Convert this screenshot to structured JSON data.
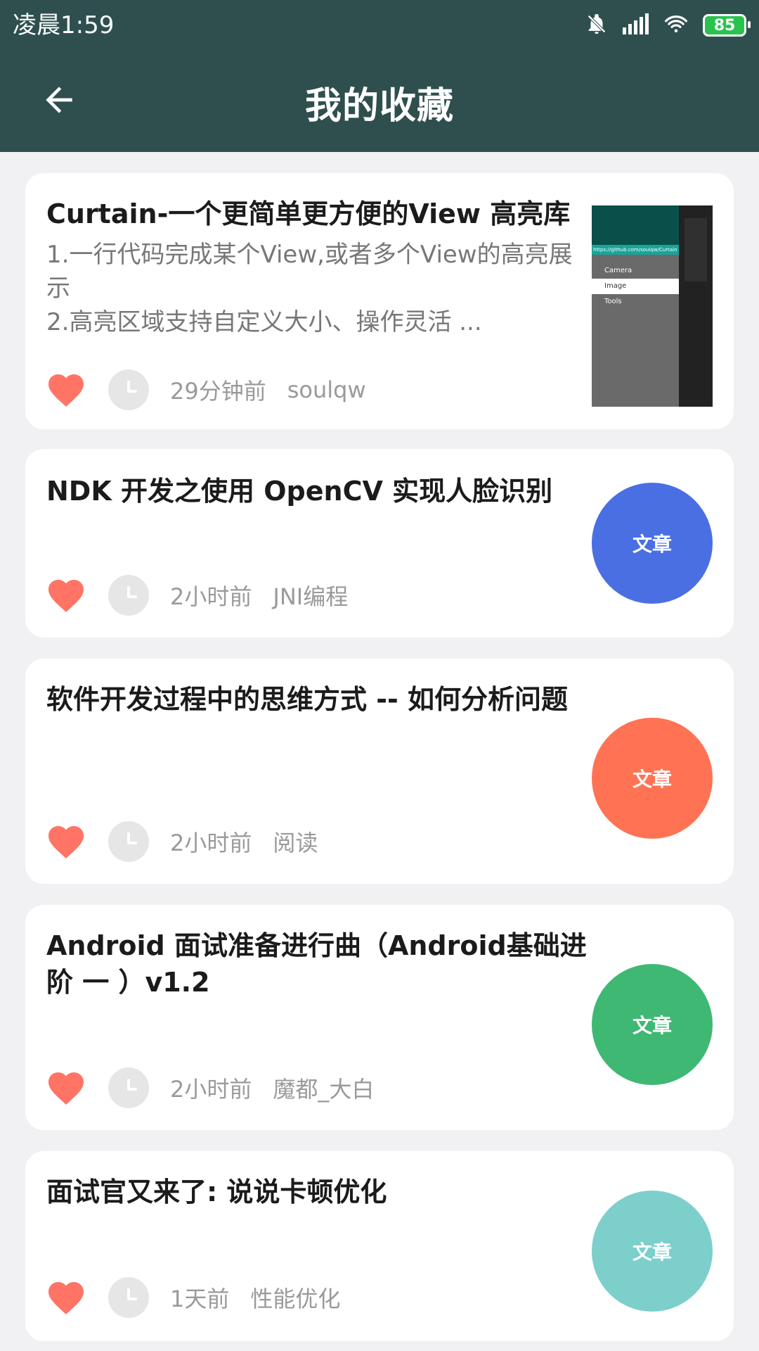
{
  "status": {
    "time": "凌晨1:59",
    "battery": "85"
  },
  "appbar": {
    "title": "我的收藏"
  },
  "colors": {
    "appbar": "#2f4f4f",
    "heart": "#ff7465",
    "badge_blue": "#4a6fe3",
    "badge_orange": "#ff7354",
    "badge_green": "#3fb874",
    "badge_teal": "#7ccfcb"
  },
  "items": [
    {
      "title": "Curtain-一个更简单更方便的View 高亮库",
      "desc": "1.一行代码完成某个View,或者多个View的高亮展示\n2.高亮区域支持自定义大小、操作灵活 ...",
      "time": "29分钟前",
      "author": "soulqw",
      "thumbnail_url_text": "https://github.com/soulqw/Curtain",
      "thumbnail_items": [
        "Camera",
        "Image",
        "Tools"
      ]
    },
    {
      "title": "NDK 开发之使用 OpenCV 实现人脸识别",
      "desc": "",
      "time": "2小时前",
      "author": "JNI编程",
      "badge": "文章"
    },
    {
      "title": "软件开发过程中的思维方式 -- 如何分析问题",
      "desc": "",
      "time": "2小时前",
      "author": "阅读",
      "badge": "文章"
    },
    {
      "title": "Android 面试准备进行曲（Android基础进阶 一 ）v1.2",
      "desc": "",
      "time": "2小时前",
      "author": "魔都_大白",
      "badge": "文章"
    },
    {
      "title": "面试官又来了: 说说卡顿优化",
      "desc": "",
      "time": "1天前",
      "author": "性能优化",
      "badge": "文章"
    }
  ]
}
